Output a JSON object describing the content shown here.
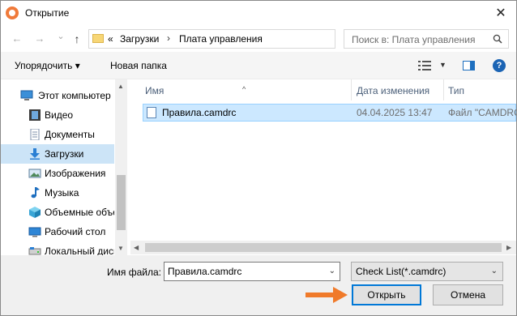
{
  "window": {
    "title": "Открытие",
    "close_glyph": "✕"
  },
  "nav": {
    "back": "←",
    "forward": "→",
    "history": "⌄",
    "up": "↑"
  },
  "address": {
    "prefix": "«",
    "segments": [
      "Загрузки",
      "Плата управления"
    ],
    "separator": "›",
    "dropdown": "⌄",
    "refresh": "↻"
  },
  "search": {
    "placeholder": "Поиск в: Плата управления"
  },
  "toolbar": {
    "organize": "Упорядочить ▾",
    "new_folder": "Новая папка",
    "view_dropdown": "▼",
    "help": "?"
  },
  "sidebar": {
    "items": [
      {
        "label": "Этот компьютер",
        "icon": "computer-icon"
      },
      {
        "label": "Видео",
        "icon": "video-icon"
      },
      {
        "label": "Документы",
        "icon": "documents-icon"
      },
      {
        "label": "Загрузки",
        "icon": "downloads-icon",
        "selected": true
      },
      {
        "label": "Изображения",
        "icon": "images-icon"
      },
      {
        "label": "Музыка",
        "icon": "music-icon"
      },
      {
        "label": "Объемные объекты",
        "icon": "3d-objects-icon"
      },
      {
        "label": "Рабочий стол",
        "icon": "desktop-icon"
      },
      {
        "label": "Локальный диск",
        "icon": "drive-icon"
      }
    ],
    "scroll_up": "▲",
    "scroll_down": "▼"
  },
  "files": {
    "columns": [
      "Имя",
      "Дата изменения",
      "Тип"
    ],
    "sort_indicator": "^",
    "rows": [
      {
        "name": "Правила.camdrc",
        "modified": "04.04.2025 13:47",
        "type": "Файл \"CAMDRC\"",
        "selected": true
      }
    ],
    "scroll_left": "◀",
    "scroll_right": "▶"
  },
  "footer": {
    "filename_label": "Имя файла:",
    "filename_value": "Правила.camdrc",
    "dropdown": "⌄",
    "filter_value": "Check List(*.camdrc)",
    "open_button": "Открыть",
    "cancel_button": "Отмена"
  },
  "colors": {
    "accent": "#0078d7",
    "selection": "#cce8ff",
    "annotation_arrow": "#f07a2a",
    "app_icon": "#f07a3a"
  }
}
